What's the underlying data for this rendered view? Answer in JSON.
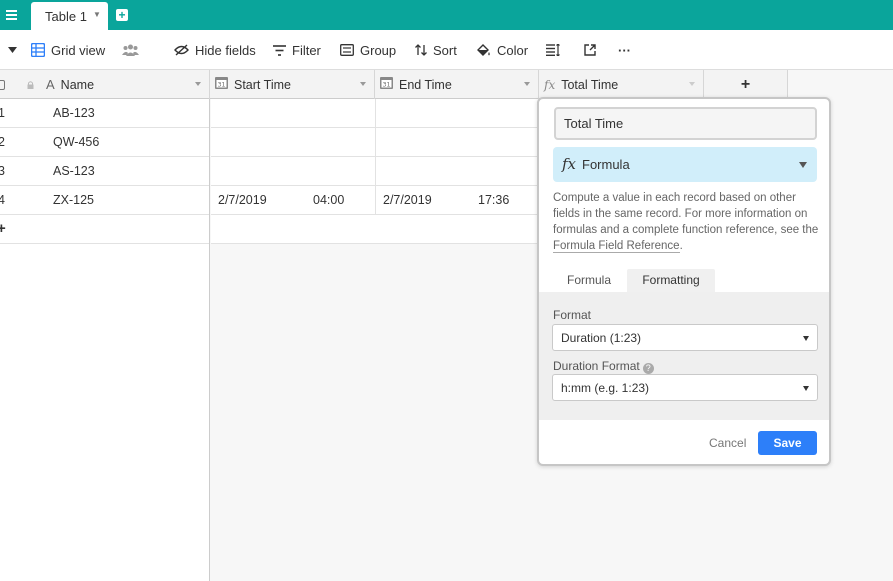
{
  "tabs": {
    "active_label": "Table 1"
  },
  "toolbar": {
    "view_label": "Grid view",
    "hide_fields": "Hide fields",
    "filter": "Filter",
    "group": "Group",
    "sort": "Sort",
    "color": "Color",
    "more": "···"
  },
  "columns": {
    "name": "Name",
    "start": "Start Time",
    "end": "End Time",
    "total": "Total Time",
    "add": "+"
  },
  "rows": [
    {
      "num": "1",
      "name": "AB-123",
      "start_date": "",
      "start_time": "",
      "end_date": "",
      "end_time": ""
    },
    {
      "num": "2",
      "name": "QW-456",
      "start_date": "",
      "start_time": "",
      "end_date": "",
      "end_time": ""
    },
    {
      "num": "3",
      "name": "AS-123",
      "start_date": "",
      "start_time": "",
      "end_date": "",
      "end_time": ""
    },
    {
      "num": "4",
      "name": "ZX-125",
      "start_date": "2/7/2019",
      "start_time": "04:00",
      "end_date": "2/7/2019",
      "end_time": "17:36"
    }
  ],
  "add_row": "+",
  "panel": {
    "field_name": "Total Time",
    "field_type": "Formula",
    "fx_glyph": "fx",
    "description_before": "Compute a value in each record based on other fields in the same record. For more information on formulas and a complete function reference, see the ",
    "description_link": "Formula Field Reference",
    "description_after": ".",
    "subtab_formula": "Formula",
    "subtab_formatting": "Formatting",
    "format_label": "Format",
    "format_value": "Duration (1:23)",
    "duration_label": "Duration Format",
    "duration_value": "h:mm (e.g. 1:23)",
    "cancel": "Cancel",
    "save": "Save"
  },
  "colors": {
    "topbar": "#0aa59b",
    "save_button": "#2d7ff9",
    "type_select_bg": "#d1eefa",
    "view_icon": "#2d7ff9"
  }
}
